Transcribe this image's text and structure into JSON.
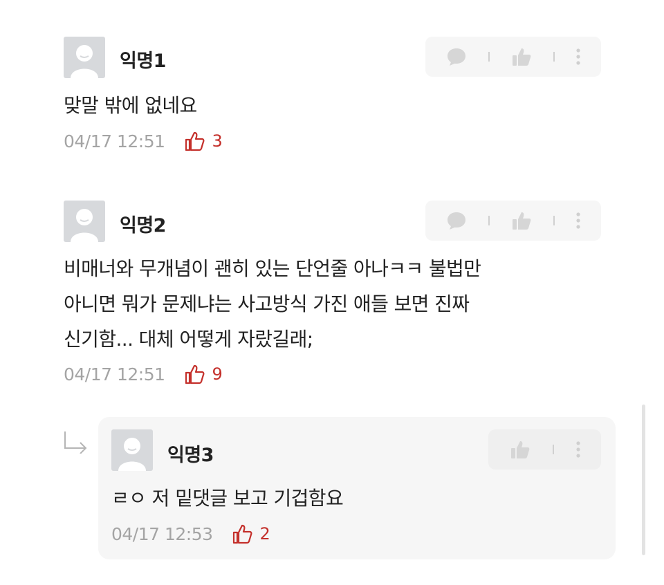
{
  "colors": {
    "like": "#c4302b",
    "meta": "#a4a4a4",
    "text": "#222222",
    "panel": "#f6f6f6"
  },
  "comments": [
    {
      "author": "익명1",
      "lines": [
        "맞말 밖에 없네요"
      ],
      "time": "04/17 12:51",
      "likes": "3",
      "icons": [
        "comment-icon",
        "thumb-up-icon",
        "more-vertical-icon"
      ]
    },
    {
      "author": "익명2",
      "lines": [
        "비매너와 무개념이 괜히 있는 단언줄 아나ㅋㅋ 불법만",
        "아니면 뭐가 문제냐는 사고방식 가진 애들 보면 진짜",
        "신기함... 대체 어떻게 자랐길래;"
      ],
      "time": "04/17 12:51",
      "likes": "9",
      "icons": [
        "comment-icon",
        "thumb-up-icon",
        "more-vertical-icon"
      ]
    }
  ],
  "reply": {
    "author": "익명3",
    "lines": [
      "ㄹㅇ 저 밑댓글 보고 기겁함요"
    ],
    "time": "04/17 12:53",
    "likes": "2",
    "icons": [
      "reply-arrow-icon",
      "thumb-up-icon",
      "more-vertical-icon"
    ]
  }
}
